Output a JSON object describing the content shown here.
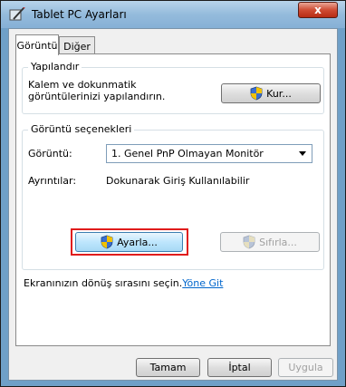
{
  "window": {
    "title": "Tablet PC Ayarları",
    "close_glyph": "x",
    "icon": "tablet-pen-icon"
  },
  "tabs": [
    {
      "label": "Görüntü",
      "active": true
    },
    {
      "label": "Diğer",
      "active": false
    }
  ],
  "configure_group": {
    "title": "Yapılandır",
    "description_line1": "Kalem ve dokunmatik",
    "description_line2": "görüntülerinizi yapılandırın.",
    "button_label": "Kur..."
  },
  "display_options_group": {
    "title": "Görüntü seçenekleri",
    "display_label": "Görüntü:",
    "display_value": "1. Genel PnP Olmayan Monitör",
    "details_label": "Ayrıntılar:",
    "details_value": "Dokunarak Giriş Kullanılabilir",
    "calibrate_button": "Ayarla...",
    "reset_button": "Sıfırla..."
  },
  "rotation": {
    "text": "Ekranınızın dönüş sırasını seçin.",
    "link": "Yöne Git"
  },
  "footer": {
    "ok": "Tamam",
    "cancel": "İptal",
    "apply": "Uygula"
  },
  "colors": {
    "highlight": "#e01c1c",
    "link": "#0066cc",
    "titlebar": "#94bbdc"
  }
}
